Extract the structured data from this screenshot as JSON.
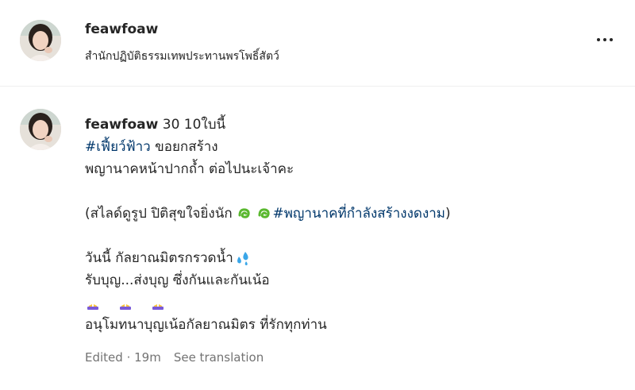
{
  "post": {
    "username": "feawfoaw",
    "location": "สำนักปฏิบัติธรรมเทพประทานพรโพธิ์สัตว์"
  },
  "comment": {
    "username": "feawfoaw",
    "line1_rest": " 30 10ใบนี้",
    "tag1": "#เฟี้ยว์ฟ้าว",
    "line2_rest": " ขอยกสร้าง",
    "line3": "พญานาคหน้าปากถ้ำ ต่อไปนะเจ้าคะ",
    "line5_start": "(สไลด์ดูรูป ปิติสุขใจยิ่งนัก ",
    "tag2": "#พญานาคที่กำลังสร้างงดงาม",
    "line5_end": ")",
    "line7": "วันนี้ กัลยาณมิตรกรวดน้ำ",
    "line8": "รับบุญ...ส่งบุญ ซึ่งกันและกันเน้อ",
    "line10": "อนุโมทนาบุญเน้อกัลยาณมิตร ที่รักทุกท่าน",
    "edited": "Edited · 19m",
    "see_translation": "See translation"
  },
  "icons": {
    "more": "more-options-icon",
    "emoji_green": "green-heart-curl-emoji",
    "emoji_water": "water-drops-emoji",
    "emoji_pray": "praying-hands-emoji"
  },
  "colors": {
    "hashtag": "#00376b",
    "meta": "#737373",
    "text": "#262626"
  }
}
